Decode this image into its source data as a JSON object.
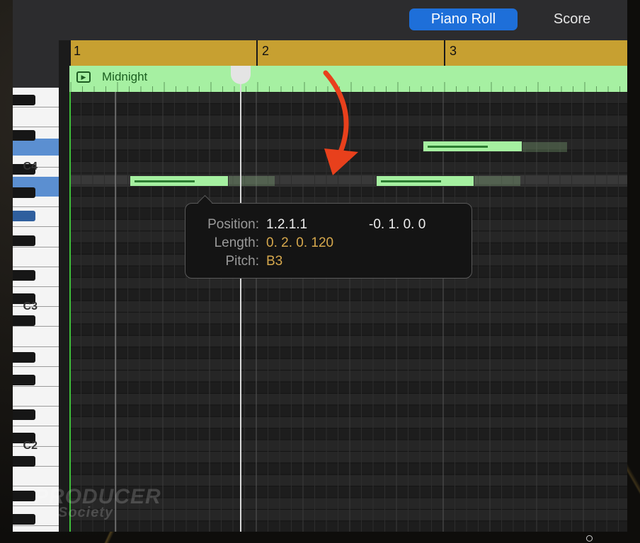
{
  "tabs": [
    {
      "label": "Piano Roll",
      "active": true
    },
    {
      "label": "Score",
      "active": false
    }
  ],
  "ruler": {
    "bars": [
      "1",
      "2",
      "3"
    ]
  },
  "region": {
    "name": "Midnight",
    "icon": "play-icon"
  },
  "keyboard": {
    "labels": [
      "C4",
      "C3",
      "C2"
    ]
  },
  "tooltip": {
    "position_label": "Position:",
    "position_value": "1.2.1.1",
    "position_delta": "-0. 1. 0. 0",
    "length_label": "Length:",
    "length_value": "0. 2. 0. 120",
    "pitch_label": "Pitch:",
    "pitch_value": "B3"
  },
  "watermark": {
    "line1": "PRODUCER",
    "line2": "Society"
  },
  "colors": {
    "accent_tab": "#1e6fd9",
    "ruler": "#c7a031",
    "region": "#a6f0a2",
    "note": "#a5f0a0",
    "annotation_arrow": "#e8401c",
    "tooltip_value_highlight": "#d6a84d"
  }
}
